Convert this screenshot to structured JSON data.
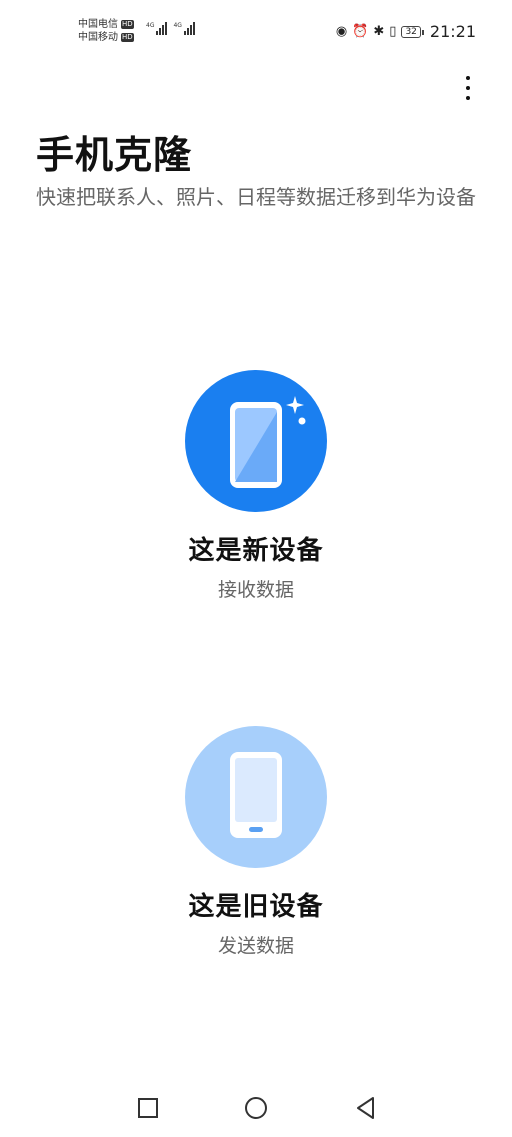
{
  "status_bar": {
    "carrier_1": "中国电信",
    "carrier_2": "中国移动",
    "hd_badge": "HD",
    "network_1": "4G",
    "network_2": "4G",
    "icons": [
      "eye-icon",
      "alarm-icon",
      "bluetooth-icon",
      "vibrate-icon"
    ],
    "battery": "32",
    "time": "21:21"
  },
  "header": {
    "title": "手机克隆",
    "subtitle": "快速把联系人、照片、日程等数据迁移到华为设备"
  },
  "options": {
    "new_device": {
      "label": "这是新设备",
      "sub": "接收数据",
      "icon": "new-phone-icon",
      "color": "#1a7ff0"
    },
    "old_device": {
      "label": "这是旧设备",
      "sub": "发送数据",
      "icon": "old-phone-icon",
      "color": "#a7cffb"
    }
  },
  "nav_bar": {
    "back": "back-icon",
    "home": "home-icon",
    "recent": "recent-apps-icon"
  }
}
